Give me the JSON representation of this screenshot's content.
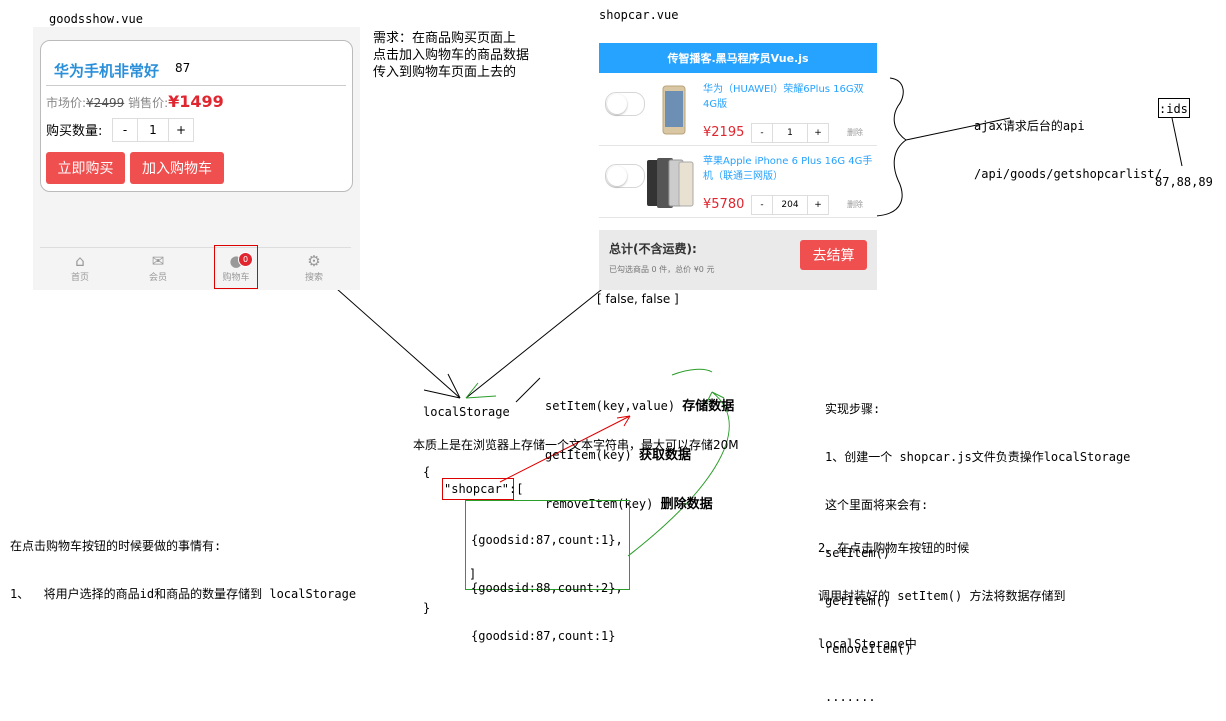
{
  "labels": {
    "goodsshow_file": "goodsshow.vue",
    "shopcar_file": "shopcar.vue",
    "requirement": [
      "需求：在商品购买页面上",
      "点击加入购物车的商品数据",
      "传入到购物车页面上去的"
    ],
    "ajax": [
      "ajax请求后台的api",
      "/api/goods/getshopcarlist/"
    ],
    "ajax_ids": ":ids",
    "ids_value": "87,88,89",
    "false_pair": "[ false, false ]",
    "local_storage": "localStorage",
    "set_item": "setItem(key,value)",
    "set_item_desc": "存储数据",
    "get_item": "getItem(key)",
    "get_item_desc": "获取数据",
    "remove_item": "removeItem(key)",
    "remove_item_desc": "删除数据",
    "essence": "本质上是在浏览器上存储一个文本字符串，最大可以存储20M",
    "json_open": "{",
    "json_key": "\"shopcar\":",
    "json_bracket": "[",
    "json_rows": [
      "{goodsid:87,count:1},",
      "{goodsid:88,count:2},",
      "{goodsid:87,count:1}"
    ],
    "json_close_bracket": "]",
    "json_close": "}",
    "left_note": [
      "在点击购物车按钮的时候要做的事情有:",
      "1、  将用户选择的商品id和商品的数量存储到 localStorage"
    ],
    "steps": [
      "实现步骤:",
      "1、创建一个 shopcar.js文件负责操作localStorage",
      "这个里面将来会有:",
      "setItem()",
      "getItem()",
      "removeItem()",
      "......."
    ],
    "step2": [
      "2、在点击购物车按钮的时候",
      "调用封装好的 setItem() 方法将数据存储到",
      "localStorage中"
    ]
  },
  "goodsshow": {
    "title": "华为手机非常好",
    "id": "87",
    "market_label": "市场价:",
    "market_price": "¥2499",
    "sale_label": "销售价:",
    "sale_price": "¥1499",
    "qty_label": "购买数量:",
    "qty_minus": "-",
    "qty_value": "1",
    "qty_plus": "+",
    "buy_now": "立即购买",
    "add_cart": "加入购物车",
    "tabs": [
      {
        "label": "首页",
        "icon": "home-icon"
      },
      {
        "label": "会员",
        "icon": "mail-icon"
      },
      {
        "label": "购物车",
        "icon": "cart-icon"
      },
      {
        "label": "搜索",
        "icon": "search-icon"
      }
    ],
    "cart_badge": "0"
  },
  "shopcar": {
    "header": "传智播客.黑马程序员Vue.js",
    "items": [
      {
        "title": "华为（HUAWEI）荣耀6Plus 16G双4G版",
        "price": "¥2195",
        "minus": "-",
        "qty": "1",
        "plus": "+",
        "delete": "删除"
      },
      {
        "title": "苹果Apple iPhone 6 Plus 16G 4G手机（联通三网版）",
        "price": "¥5780",
        "minus": "-",
        "qty": "204",
        "plus": "+",
        "delete": "删除"
      }
    ],
    "total_title": "总计(不含运费):",
    "total_sub": "已勾选商品 0 件，总价 ¥0 元",
    "checkout": "去结算"
  },
  "colors": {
    "brand_blue": "#26a2ff",
    "price_red": "#e0262f",
    "button_red": "#ef4f4f",
    "annotation_red": "#dd0000",
    "annotation_green": "#2a9d2a"
  }
}
